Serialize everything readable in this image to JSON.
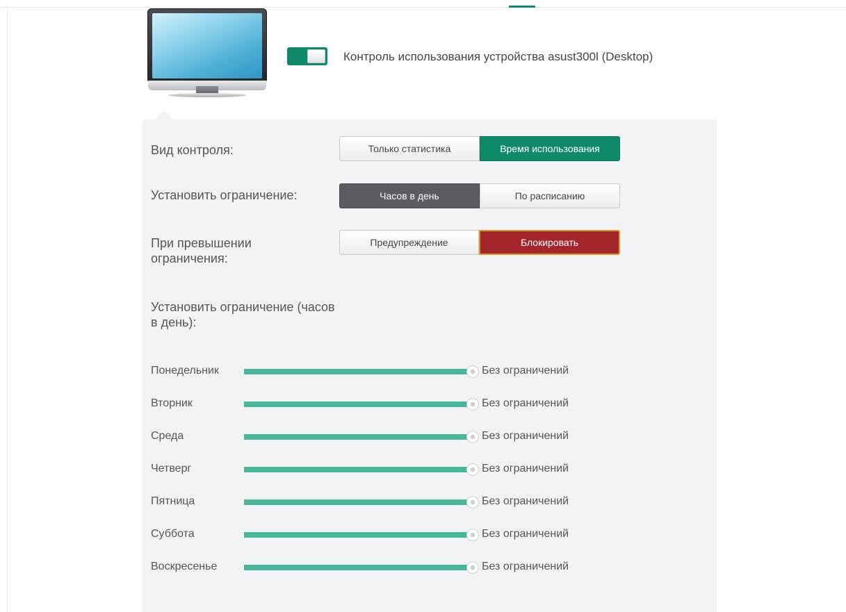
{
  "device": {
    "toggle_on": true,
    "title": "Контроль использования устройства asust300l (Desktop)"
  },
  "control_type": {
    "label": "Вид контроля:",
    "options": [
      "Только статистика",
      "Время использования"
    ],
    "selected": "Время использования"
  },
  "limit_mode": {
    "label": "Установить ограничение:",
    "options": [
      "Часов в день",
      "По расписанию"
    ],
    "selected": "Часов в день"
  },
  "on_exceed": {
    "label": "При превышении ограничения:",
    "options": [
      "Предупреждение",
      "Блокировать"
    ],
    "selected": "Блокировать"
  },
  "hours_section": {
    "label": "Установить ограничение (часов в день):"
  },
  "days": [
    {
      "name": "Понедельник",
      "value": "Без ограничений"
    },
    {
      "name": "Вторник",
      "value": "Без ограничений"
    },
    {
      "name": "Среда",
      "value": "Без ограничений"
    },
    {
      "name": "Четверг",
      "value": "Без ограничений"
    },
    {
      "name": "Пятница",
      "value": "Без ограничений"
    },
    {
      "name": "Суббота",
      "value": "Без ограничений"
    },
    {
      "name": "Воскресенье",
      "value": "Без ограничений"
    }
  ],
  "colors": {
    "accent": "#0f8a69",
    "slider": "#46b79a",
    "selected_dark": "#5a5c61",
    "block_red": "#a4262a"
  }
}
